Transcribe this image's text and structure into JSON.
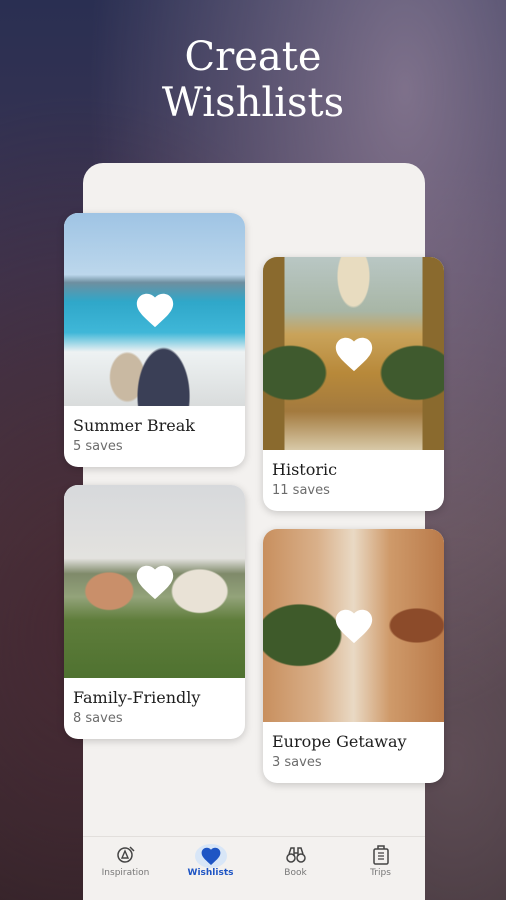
{
  "headline": {
    "line1": "Create",
    "line2": "Wishlists"
  },
  "wishlists": [
    {
      "title": "Summer Break",
      "saves": "5 saves"
    },
    {
      "title": "Historic",
      "saves": "11 saves"
    },
    {
      "title": "Family-Friendly",
      "saves": "8 saves"
    },
    {
      "title": "Europe Getaway",
      "saves": "3 saves"
    }
  ],
  "nav": {
    "items": [
      {
        "label": "Inspiration",
        "icon": "compass-pen-icon",
        "active": false
      },
      {
        "label": "Wishlists",
        "icon": "heart-icon",
        "active": true
      },
      {
        "label": "Book",
        "icon": "binoculars-icon",
        "active": false
      },
      {
        "label": "Trips",
        "icon": "suitcase-icon",
        "active": false
      }
    ]
  },
  "colors": {
    "accent": "#1e55c4",
    "card_bg": "#ffffff",
    "panel_bg": "#f3f1ef"
  }
}
